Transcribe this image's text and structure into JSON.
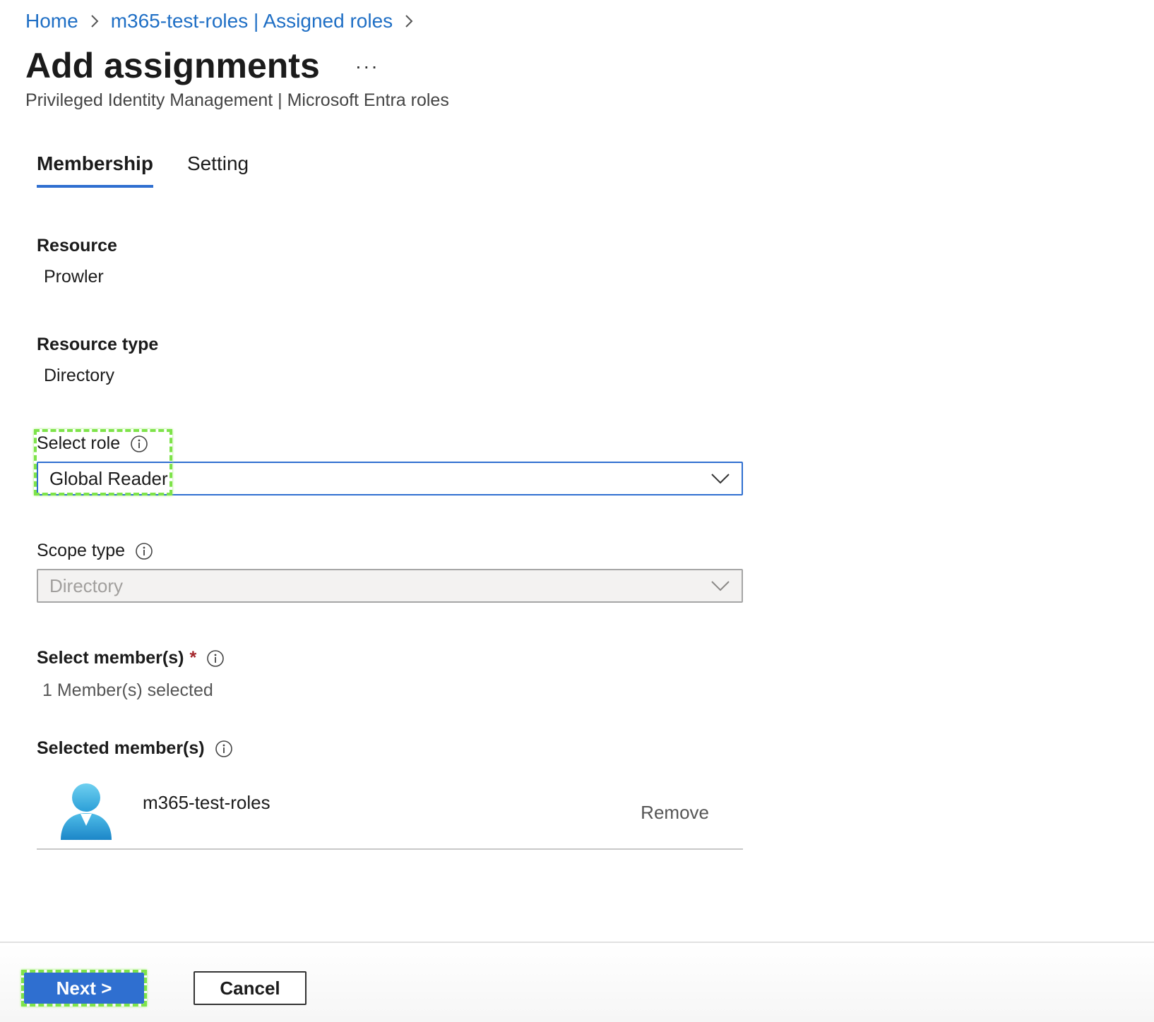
{
  "breadcrumb": {
    "items": [
      "Home",
      "m365-test-roles | Assigned roles"
    ]
  },
  "header": {
    "title": "Add assignments",
    "more": "···",
    "subtitle": "Privileged Identity Management | Microsoft Entra roles"
  },
  "tabs": [
    {
      "label": "Membership",
      "active": true
    },
    {
      "label": "Setting",
      "active": false
    }
  ],
  "form": {
    "resource": {
      "label": "Resource",
      "value": "Prowler"
    },
    "resource_type": {
      "label": "Resource type",
      "value": "Directory"
    },
    "select_role": {
      "label": "Select role",
      "value": "Global Reader"
    },
    "scope_type": {
      "label": "Scope type",
      "value": "Directory"
    },
    "select_members": {
      "label": "Select member(s)",
      "required_mark": "*",
      "value": "1 Member(s) selected"
    },
    "selected_members": {
      "label": "Selected member(s)",
      "items": [
        {
          "name": "m365-test-roles",
          "action": "Remove"
        }
      ]
    }
  },
  "footer": {
    "next_label": "Next >",
    "cancel_label": "Cancel"
  },
  "colors": {
    "accent": "#2f6fd0",
    "link": "#1f6fc5",
    "highlight": "#7ee34a",
    "required": "#a4262c"
  },
  "icons": [
    "chevron-right-icon",
    "info-icon",
    "chevron-down-icon",
    "user-avatar-icon"
  ]
}
